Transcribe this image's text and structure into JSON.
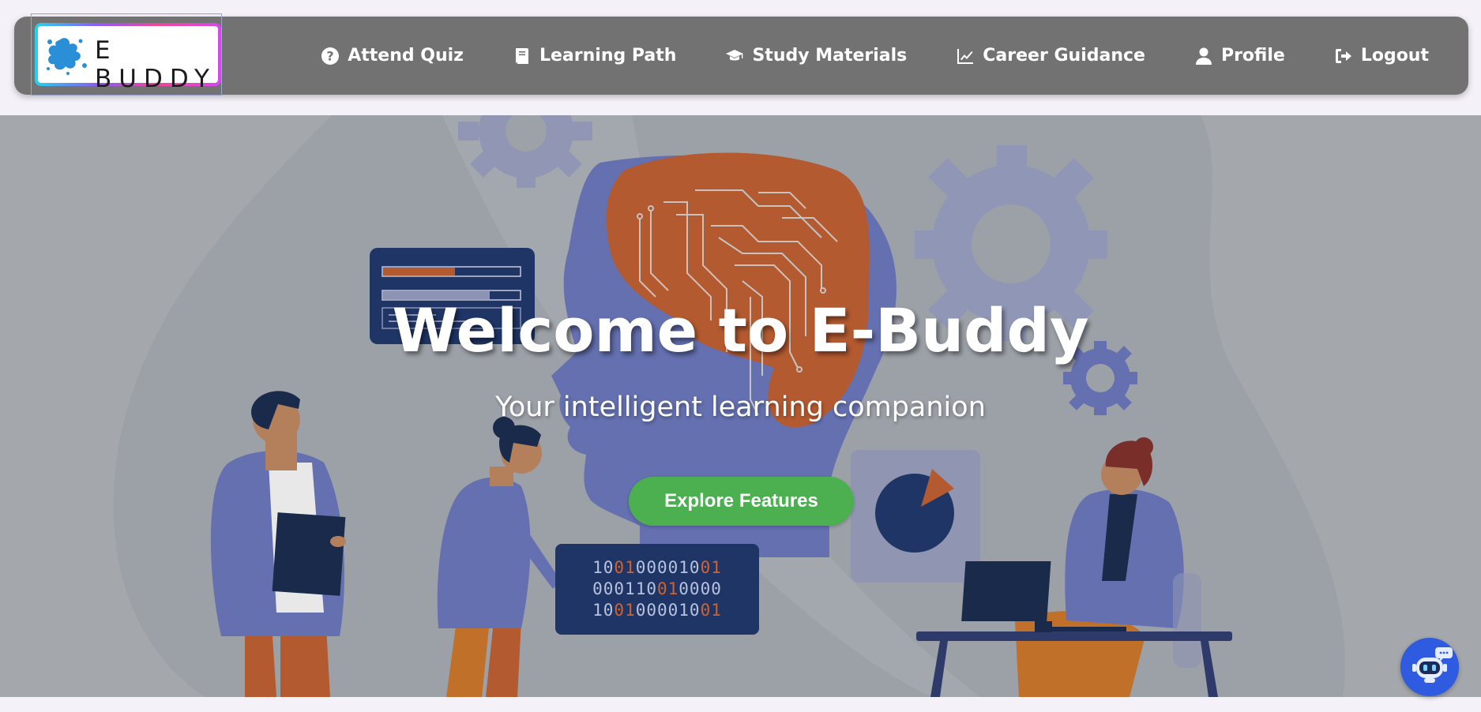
{
  "brand": {
    "logo_text": "E BUDDY"
  },
  "nav": {
    "items": [
      {
        "label": "Attend Quiz",
        "icon": "question-circle-icon"
      },
      {
        "label": "Learning Path",
        "icon": "book-icon"
      },
      {
        "label": "Study Materials",
        "icon": "graduation-cap-icon"
      },
      {
        "label": "Career Guidance",
        "icon": "line-chart-icon"
      },
      {
        "label": "Profile",
        "icon": "user-icon"
      },
      {
        "label": "Logout",
        "icon": "sign-out-icon"
      }
    ]
  },
  "hero": {
    "title": "Welcome to E-Buddy",
    "subtitle": "Your intelligent learning companion",
    "cta_label": "Explore Features",
    "binary_rows": [
      [
        "10",
        "01",
        "000010",
        "01"
      ],
      [
        "000110",
        "01",
        "0000",
        ""
      ],
      [
        "10",
        "01",
        "000010",
        "01"
      ]
    ]
  },
  "colors": {
    "navbar": "#727272",
    "hero_bg": "#a4a8ad",
    "cta": "#4caf50",
    "head": "#6470b0",
    "brain": "#b45a30",
    "chatbot": "#2e5be0"
  },
  "chatbot": {
    "icon": "robot-chat-icon"
  }
}
